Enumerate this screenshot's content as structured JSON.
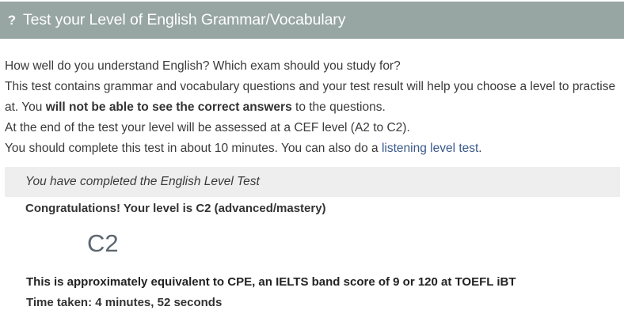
{
  "header": {
    "icon": "question-mark-icon",
    "icon_glyph": "?",
    "title": "Test your Level of English Grammar/Vocabulary",
    "background_color": "#97a5a3"
  },
  "intro": {
    "line1": "How well do you understand English? Which exam should you study for?",
    "line2": "This test contains grammar and vocabulary questions and your test result will help you choose a level to practise at. You ",
    "line2_bold": "will not be able to see the correct answers",
    "line2_end": " to the questions.",
    "line3": "At the end of the test your level will be assessed at a CEF level (A2 to C2).",
    "line4": "You should complete this test in about 10 minutes. You can also do a ",
    "line4_link": "listening level test",
    "line4_end": "."
  },
  "result": {
    "completed_message": "You have completed the English Level Test",
    "congrats": "Congratulations! Your level is C2 (advanced/mastery)",
    "level_code": "C2",
    "equivalence": "This is approximately equivalent to CPE, an IELTS band score of 9 or 120 at TOEFL iBT",
    "time_taken": "Time taken: 4 minutes, 52 seconds"
  }
}
